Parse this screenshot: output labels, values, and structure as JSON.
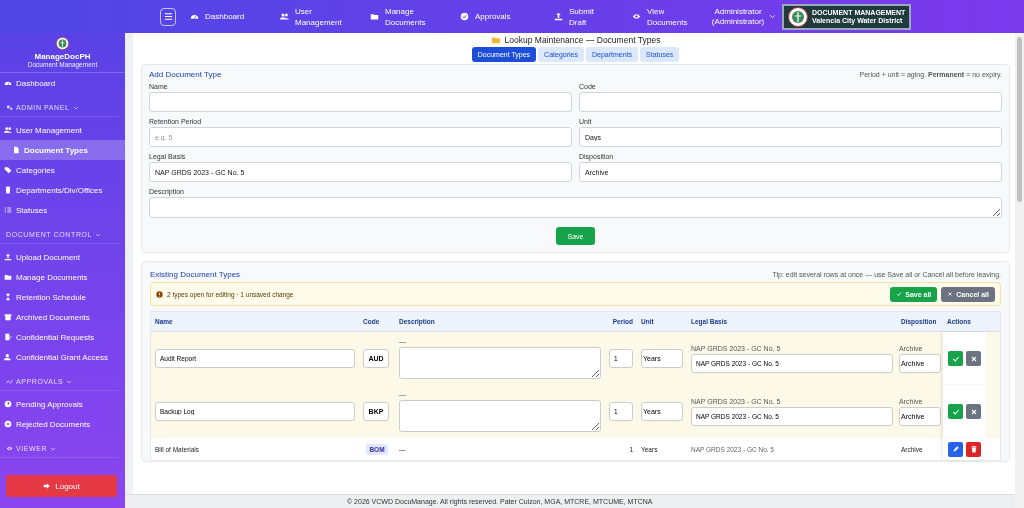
{
  "nav": {
    "items": [
      {
        "label": "Dashboard"
      },
      {
        "label": "User Management"
      },
      {
        "label": "Manage Documents"
      },
      {
        "label": "Approvals"
      },
      {
        "label": "Submit Draft"
      },
      {
        "label": "View Documents"
      }
    ],
    "user": "Administrator (Administrator)",
    "brand": {
      "line1": "DOCUMENT MANAGEMENT",
      "line2": "Valencia City Water District"
    }
  },
  "sidebar": {
    "app_name": "ManageDocPH",
    "app_subtitle": "Document Management",
    "sections": [
      {
        "items": [
          {
            "label": "Dashboard",
            "selected": false
          }
        ]
      },
      {
        "heading": "ADMIN PANEL",
        "items": [
          {
            "label": "User Management",
            "selected": false
          },
          {
            "label": "Document Types",
            "selected": true
          },
          {
            "label": "Categories",
            "selected": false
          },
          {
            "label": "Departments/Div/Offices",
            "selected": false
          },
          {
            "label": "Statuses",
            "selected": false
          }
        ]
      },
      {
        "heading": "DOCUMENT CONTROL",
        "items": [
          {
            "label": "Upload Document",
            "selected": false
          },
          {
            "label": "Manage Documents",
            "selected": false
          },
          {
            "label": "Retention Schedule",
            "selected": false
          },
          {
            "label": "Archived Documents",
            "selected": false
          },
          {
            "label": "Confidential Requests",
            "selected": false
          },
          {
            "label": "Confidential Grant Access",
            "selected": false
          }
        ]
      },
      {
        "heading": "APPROVALS",
        "items": [
          {
            "label": "Pending Approvals",
            "selected": false
          },
          {
            "label": "Rejected Documents",
            "selected": false
          }
        ]
      },
      {
        "heading": "VIEWER"
      }
    ],
    "logout": "Logout"
  },
  "page_title": "Lookup Maintenance — Document Types",
  "tabs": [
    {
      "label": "Document Types",
      "selected": true
    },
    {
      "label": "Categories",
      "selected": false
    },
    {
      "label": "Departments",
      "selected": false
    },
    {
      "label": "Statuses",
      "selected": false
    }
  ],
  "add_form": {
    "title": "Add Document Type",
    "hint": "Period + unit = aging. **Permanent** = no expiry.",
    "fields": [
      {
        "kind": "input",
        "label": "Name"
      },
      {
        "kind": "input",
        "label": "Code"
      },
      {
        "kind": "input",
        "label": "Retention Period",
        "placeholder": "e.g. 5"
      },
      {
        "kind": "select",
        "label": "Unit",
        "value": "Days"
      },
      {
        "kind": "input",
        "label": "Legal Basis",
        "value": "NAP GRDS 2023 - GC No. 5"
      },
      {
        "kind": "select",
        "label": "Disposition",
        "value": "Archive"
      },
      {
        "kind": "textarea",
        "label": "Description"
      }
    ],
    "save": "Save"
  },
  "existing": {
    "title": "Existing Document Types",
    "tip": "Tip: edit several rows at once — use Save all or Cancel all before leaving.",
    "alert": "2 types open for editing · 1 unsaved change",
    "save_all": "Save all",
    "cancel_all": "Cancel all",
    "columns": [
      "Name",
      "Code",
      "Description",
      "Period",
      "Unit",
      "Legal Basis",
      "Disposition",
      "Actions"
    ],
    "rows": [
      {
        "kind": "editing",
        "name": "Audit Report",
        "code": "AUD",
        "description_label": "—",
        "period": "1",
        "unit": "Years",
        "legal_basis_label": "NAP GRDS 2023 - GC No. 5",
        "legal_basis": "NAP GRDS 2023 - GC No. 5",
        "disposition_label": "Archive",
        "disposition": "Archive"
      },
      {
        "kind": "editing",
        "name": "Backup Log",
        "code": "BKP",
        "description_label": "—",
        "period": "1",
        "unit": "Years",
        "legal_basis_label": "NAP GRDS 2023 - GC No. 5",
        "legal_basis": "NAP GRDS 2023 - GC No. 5",
        "disposition_label": "Archive",
        "disposition": "Archive"
      },
      {
        "kind": "view",
        "name": "Bill of Materials",
        "code": "BOM",
        "description": "—",
        "period": "1",
        "unit": "Years",
        "legal_basis": "NAP GRDS 2023 - GC No. 5",
        "disposition": "Archive"
      }
    ]
  },
  "footer": "© 2026 VCWD DocuManage. All rights reserved. Pater Cuizon, MGA, MTCRE, MTCUME, MTCNA"
}
